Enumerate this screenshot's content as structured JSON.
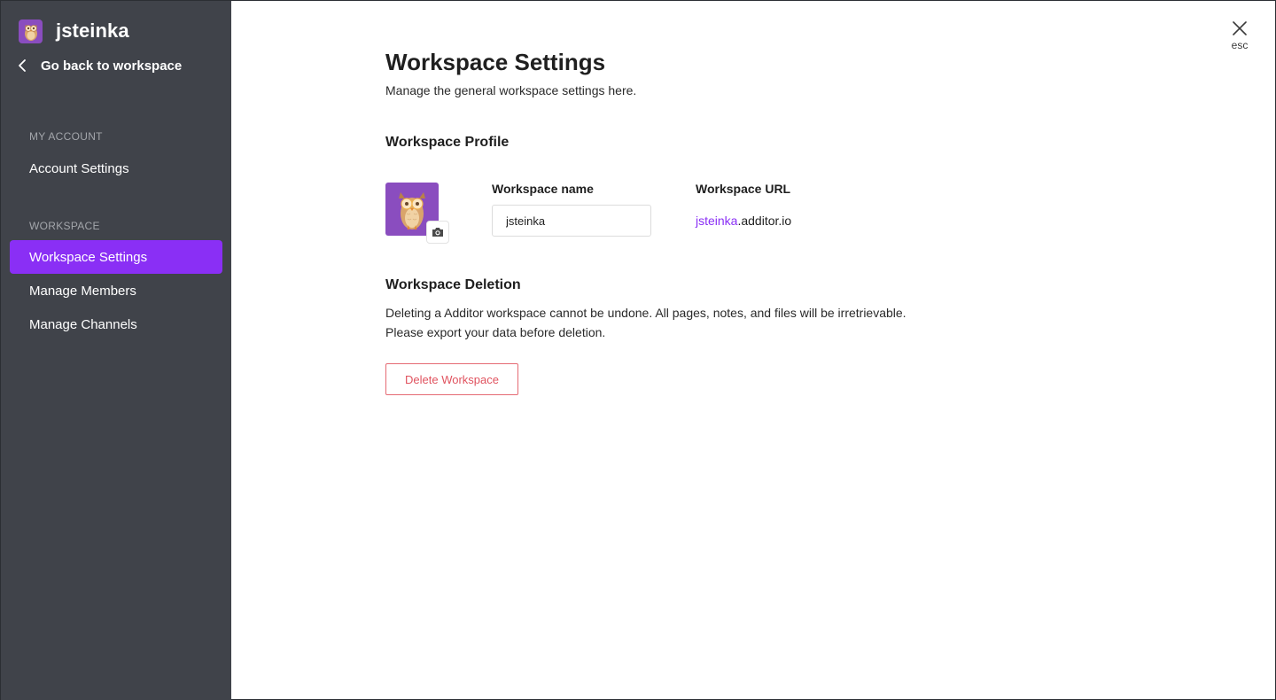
{
  "workspace": {
    "name": "jsteinka",
    "logo_icon": "owl-icon"
  },
  "sidebar": {
    "back_label": "Go back to workspace",
    "sections": [
      {
        "title": "MY ACCOUNT",
        "items": [
          {
            "label": "Account Settings",
            "active": false
          }
        ]
      },
      {
        "title": "WORKSPACE",
        "items": [
          {
            "label": "Workspace Settings",
            "active": true
          },
          {
            "label": "Manage Members",
            "active": false
          },
          {
            "label": "Manage Channels",
            "active": false
          }
        ]
      }
    ]
  },
  "header": {
    "close_icon": "close-icon",
    "esc_label": "esc"
  },
  "main": {
    "title": "Workspace Settings",
    "subtitle": "Manage the general workspace settings here.",
    "profile": {
      "heading": "Workspace Profile",
      "name_label": "Workspace name",
      "name_value": "jsteinka",
      "url_label": "Workspace URL",
      "url_subdomain": "jsteinka",
      "url_domain": ".additor.io"
    },
    "deletion": {
      "heading": "Workspace Deletion",
      "line1": "Deleting a Additor workspace cannot be undone.  All pages, notes, and files will be irretrievable.",
      "line2": "Please export your data before deletion.",
      "button_label": "Delete Workspace"
    }
  },
  "colors": {
    "sidebar_bg": "#40434a",
    "accent": "#8a2ff5",
    "logo_bg": "#8a4dbf",
    "danger": "#e0535f"
  }
}
